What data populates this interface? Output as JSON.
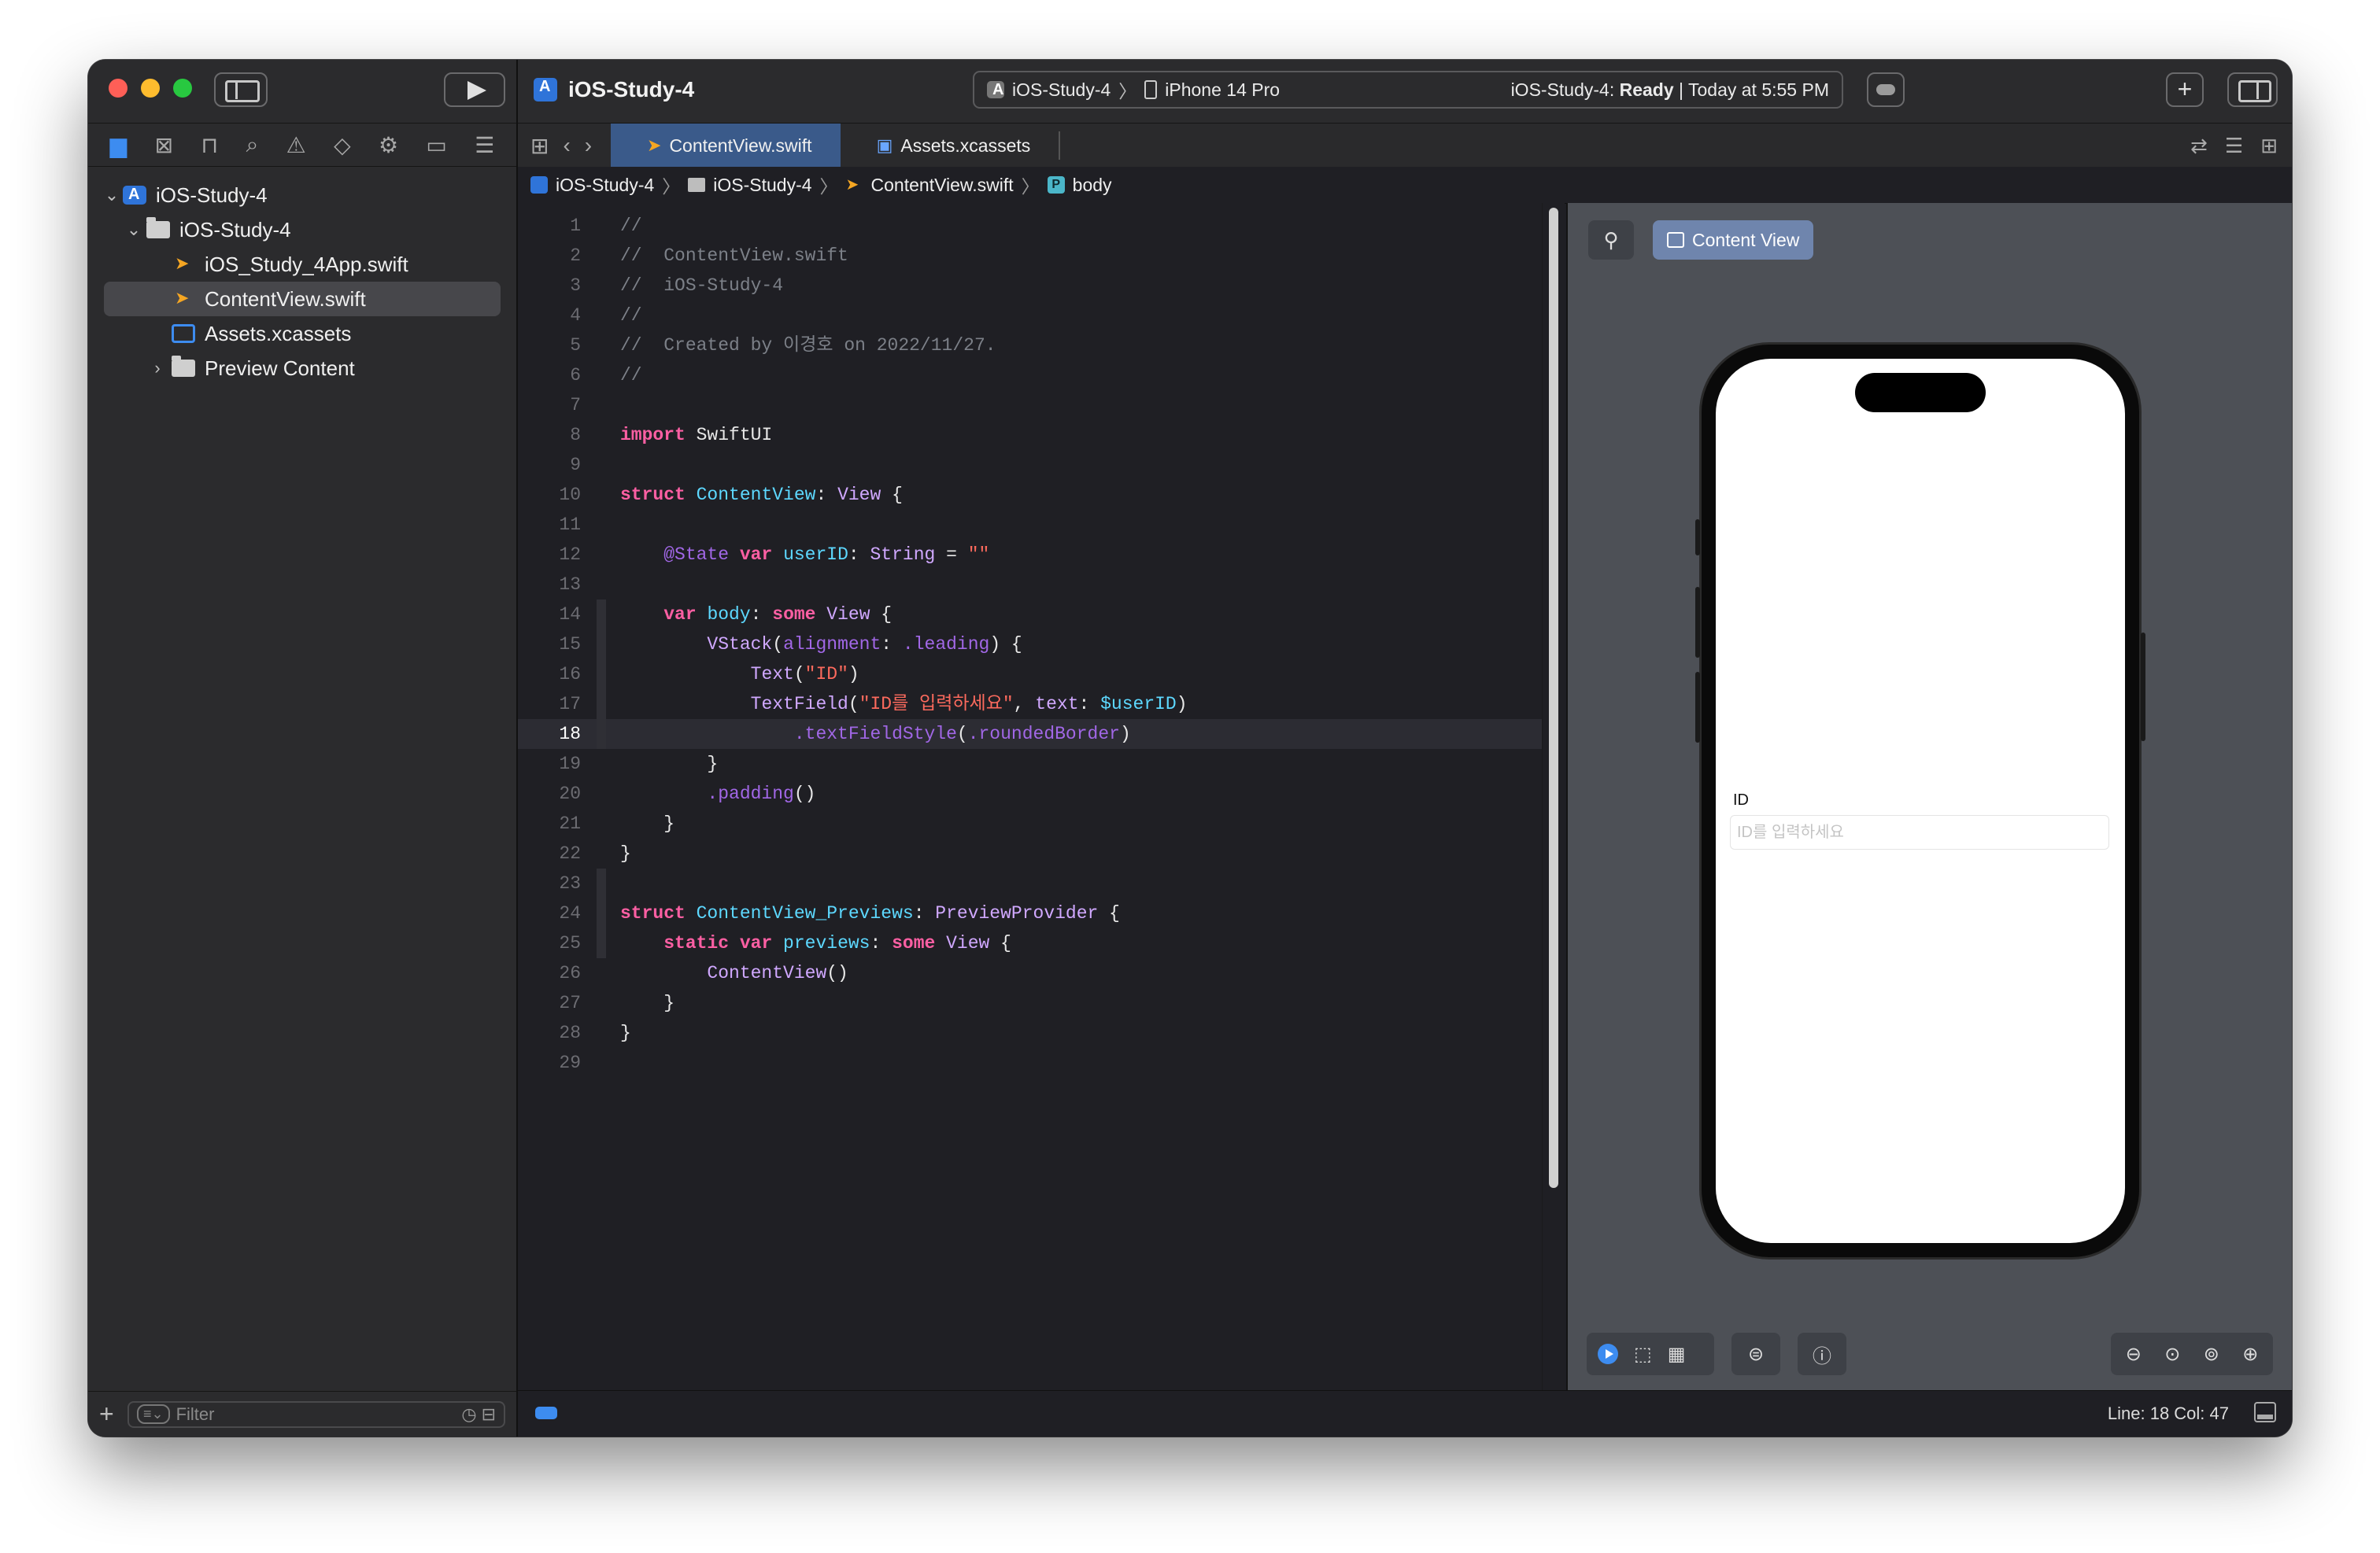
{
  "window": {
    "project_title": "iOS-Study-4",
    "scheme": "iOS-Study-4",
    "device": "iPhone 14 Pro",
    "status_prefix": "iOS-Study-4: ",
    "status_state": "Ready",
    "status_time": " | Today at 5:55 PM"
  },
  "navigator": {
    "tree": [
      {
        "label": "iOS-Study-4",
        "icon": "app-icon",
        "disclosure": "expanded"
      },
      {
        "label": "iOS-Study-4",
        "icon": "folder-icon",
        "disclosure": "expanded"
      },
      {
        "label": "iOS_Study_4App.swift",
        "icon": "swift-file-icon"
      },
      {
        "label": "ContentView.swift",
        "icon": "swift-file-icon",
        "selected": true
      },
      {
        "label": "Assets.xcassets",
        "icon": "assets-icon"
      },
      {
        "label": "Preview Content",
        "icon": "folder-icon",
        "disclosure": "collapsed"
      }
    ],
    "filter_placeholder": "Filter"
  },
  "tabs": [
    {
      "label": "ContentView.swift",
      "icon": "swift-file-icon",
      "active": true
    },
    {
      "label": "Assets.xcassets",
      "icon": "assets-icon",
      "active": false
    }
  ],
  "jumpbar": {
    "items": [
      "iOS-Study-4",
      "iOS-Study-4",
      "ContentView.swift",
      "body"
    ],
    "symbol_badge": "P"
  },
  "editor": {
    "current_line": 18,
    "line_numbers": [
      "1",
      "2",
      "3",
      "4",
      "5",
      "6",
      "7",
      "8",
      "9",
      "10",
      "11",
      "12",
      "13",
      "14",
      "15",
      "16",
      "17",
      "18",
      "19",
      "20",
      "21",
      "22",
      "23",
      "24",
      "25",
      "26",
      "27",
      "28",
      "29"
    ],
    "tokens": {
      "l1": "//",
      "l2": "//  ContentView.swift",
      "l3": "//  iOS-Study-4",
      "l4": "//",
      "l5": "//  Created by 이경호 on 2022/11/27.",
      "l6": "//",
      "l8_kw": "import",
      "l8_rest": " SwiftUI",
      "l10_kw": "struct",
      "l10_name": " ContentView",
      "l10_colon": ": ",
      "l10_type": "View",
      "l10_brace": " {",
      "l12_attr": "@State",
      "l12_kw": " var",
      "l12_name": " userID",
      "l12_colon": ": ",
      "l12_type": "String",
      "l12_eq": " = ",
      "l12_str": "\"\"",
      "l14_kw": "var",
      "l14_name": " body",
      "l14_colon": ": ",
      "l14_some": "some",
      "l14_type": " View",
      "l14_brace": " {",
      "l15_fn": "VStack",
      "l15_p1": "(",
      "l15_arg": "alignment",
      "l15_p2": ": ",
      "l15_val": ".leading",
      "l15_p3": ") {",
      "l16_fn": "Text",
      "l16_p1": "(",
      "l16_str": "\"ID\"",
      "l16_p2": ")",
      "l17_fn": "TextField",
      "l17_p1": "(",
      "l17_str": "\"ID를 입력하세요\"",
      "l17_p2": ", ",
      "l17_arg": "text",
      "l17_p3": ": ",
      "l17_var": "$userID",
      "l17_p4": ")",
      "l18_mod": ".textFieldStyle",
      "l18_p1": "(",
      "l18_val": ".roundedBorder",
      "l18_p2": ")",
      "l19": "}",
      "l20_mod": ".padding",
      "l20_p": "()",
      "l21": "}",
      "l22": "}",
      "l24_kw": "struct",
      "l24_name": " ContentView_Previews",
      "l24_colon": ": ",
      "l24_type": "PreviewProvider",
      "l24_brace": " {",
      "l25_kw": "static var",
      "l25_name": " previews",
      "l25_colon": ": ",
      "l25_some": "some",
      "l25_type": " View",
      "l25_brace": " {",
      "l26_fn": "ContentView",
      "l26_p": "()",
      "l27": "}",
      "l28": "}"
    }
  },
  "canvas": {
    "preview_label": "Content View",
    "id_label": "ID",
    "field_placeholder": "ID를 입력하세요",
    "field_value": ""
  },
  "statusbar": {
    "line_col": "Line: 18  Col: 47"
  },
  "colors": {
    "keyword": "#fc5fa3",
    "type": "#5dd8ff",
    "string": "#fc6a5d",
    "comment": "#7c8088",
    "accent": "#3d8cf0"
  }
}
